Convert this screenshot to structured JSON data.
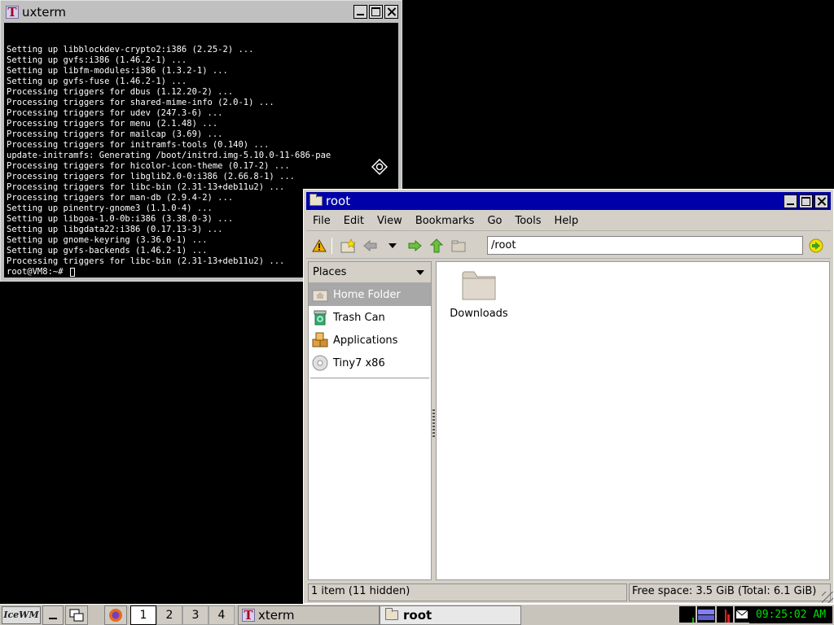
{
  "xterm": {
    "title": "uxterm",
    "lines": [
      "Setting up libblockdev-crypto2:i386 (2.25-2) ...",
      "Setting up gvfs:i386 (1.46.2-1) ...",
      "Setting up libfm-modules:i386 (1.3.2-1) ...",
      "Setting up gvfs-fuse (1.46.2-1) ...",
      "Processing triggers for dbus (1.12.20-2) ...",
      "Processing triggers for shared-mime-info (2.0-1) ...",
      "Processing triggers for udev (247.3-6) ...",
      "Processing triggers for menu (2.1.48) ...",
      "Processing triggers for mailcap (3.69) ...",
      "Processing triggers for initramfs-tools (0.140) ...",
      "update-initramfs: Generating /boot/initrd.img-5.10.0-11-686-pae",
      "Processing triggers for hicolor-icon-theme (0.17-2) ...",
      "Processing triggers for libglib2.0-0:i386 (2.66.8-1) ...",
      "Processing triggers for libc-bin (2.31-13+deb11u2) ...",
      "Processing triggers for man-db (2.9.4-2) ...",
      "Setting up pinentry-gnome3 (1.1.0-4) ...",
      "Setting up libgoa-1.0-0b:i386 (3.38.0-3) ...",
      "Setting up libgdata22:i386 (0.17.13-3) ...",
      "Setting up gnome-keyring (3.36.0-1) ...",
      "Setting up gvfs-backends (1.46.2-1) ...",
      "Processing triggers for libc-bin (2.31-13+deb11u2) ..."
    ],
    "prompt": "root@VM8:~# "
  },
  "filemanager": {
    "title": "root",
    "menu": [
      "File",
      "Edit",
      "View",
      "Bookmarks",
      "Go",
      "Tools",
      "Help"
    ],
    "path": "/root",
    "places_header": "Places",
    "places": [
      {
        "label": "Home Folder",
        "icon": "home-folder-icon",
        "selected": true
      },
      {
        "label": "Trash Can",
        "icon": "trash-icon",
        "selected": false
      },
      {
        "label": "Applications",
        "icon": "applications-icon",
        "selected": false
      },
      {
        "label": "Tiny7 x86",
        "icon": "disc-icon",
        "selected": false
      }
    ],
    "files": [
      {
        "name": "Downloads",
        "icon": "folder-icon"
      }
    ],
    "status_left": "1 item (11 hidden)",
    "status_right": "Free space: 3.5 GiB (Total: 6.1 GiB)"
  },
  "taskbar": {
    "logo": "IceWM",
    "workspaces": [
      "1",
      "2",
      "3",
      "4"
    ],
    "active_workspace": "1",
    "tasks": [
      {
        "label": "xterm",
        "active": false
      },
      {
        "label": "root",
        "active": true
      }
    ],
    "clock": "09:25:02 AM"
  }
}
